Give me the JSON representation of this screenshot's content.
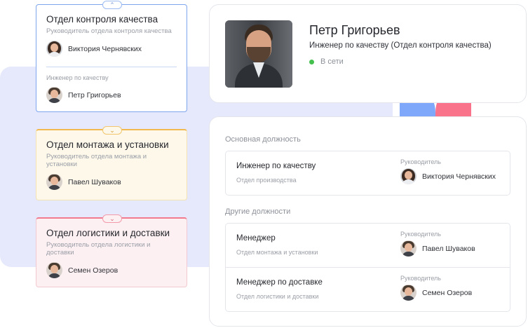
{
  "departments": [
    {
      "title": "Отдел контроля качества",
      "collapse_icon": "chevron-up-icon",
      "collapse_glyph": "⌃",
      "head_label": "Руководитель отдела контроля качества",
      "head_name": "Виктория Чернявских",
      "member_label": "Инженер по качеству",
      "member_name": "Петр Григорьев",
      "accent": "#7ea6ee"
    },
    {
      "title": "Отдел монтажа и установки",
      "collapse_icon": "chevron-down-icon",
      "collapse_glyph": "⌄",
      "head_label": "Руководитель отдела монтажа и установки",
      "head_name": "Павел Шуваков",
      "accent": "#f2b94e"
    },
    {
      "title": "Отдел логистики и доставки",
      "collapse_icon": "chevron-down-icon",
      "collapse_glyph": "⌄",
      "head_label": "Руководитель отдела логистики и доставки",
      "head_name": "Семен Озеров",
      "accent": "#f27a8e"
    }
  ],
  "profile": {
    "name": "Петр Григорьев",
    "role": "Инженер по качеству  (Отдел контроля качества)",
    "status": "В сети",
    "status_color": "#43c04d"
  },
  "positions": {
    "main_title": "Основная должность",
    "main": {
      "title": "Инженер по качеству",
      "department": "Отдел производства",
      "manager_label": "Руководитель",
      "manager_name": "Виктория Чернявских"
    },
    "other_title": "Другие должности",
    "other": [
      {
        "title": "Менеджер",
        "department": "Отдел монтажа и установки",
        "manager_label": "Руководитель",
        "manager_name": "Павел Шуваков"
      },
      {
        "title": "Менеджер по доставке",
        "department": "Отдел логистики и доставки",
        "manager_label": "Руководитель",
        "manager_name": "Семен Озеров"
      }
    ]
  },
  "colors": {
    "backdrop": "#e6e9fb",
    "shape_blue": "#7fa8fb",
    "shape_pink": "#f9738b"
  }
}
